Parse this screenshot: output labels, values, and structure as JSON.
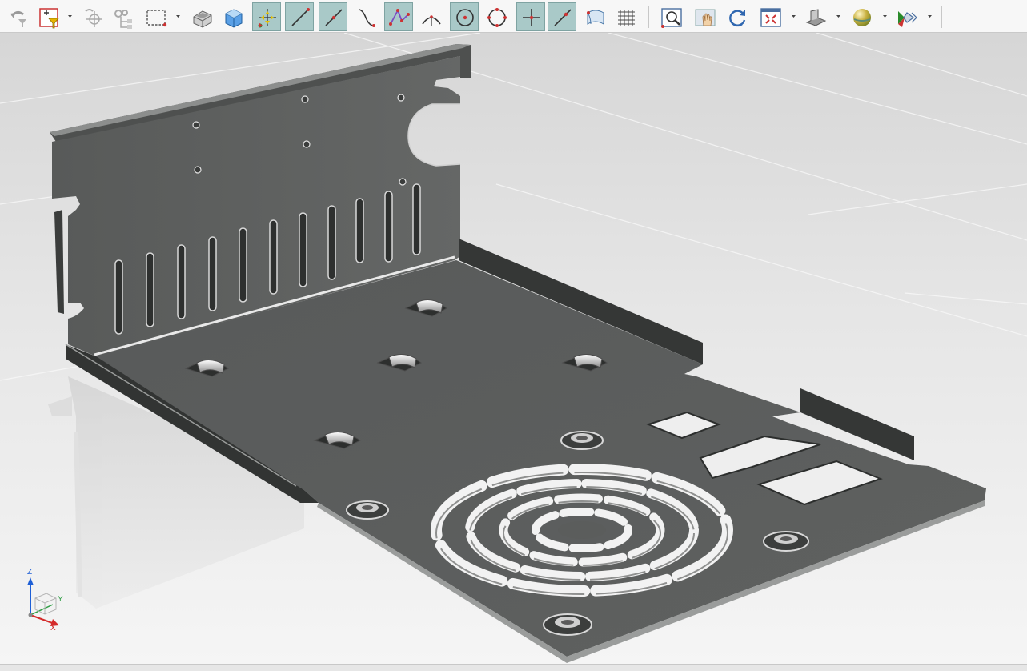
{
  "app": {
    "toolbar": {
      "buttons": [
        {
          "icon": "undo-filter-icon",
          "active": false
        },
        {
          "icon": "select-filter-icon",
          "active": false,
          "dropdown": true
        },
        {
          "icon": "point-snap-icon",
          "active": false
        },
        {
          "icon": "assembly-snap-icon",
          "active": false
        },
        {
          "icon": "box-select-icon",
          "active": false,
          "dropdown": true
        },
        {
          "icon": "part-view-icon",
          "active": false
        },
        {
          "icon": "solid-view-icon",
          "active": false
        },
        {
          "icon": "snap-points-icon",
          "active": true
        },
        {
          "icon": "line-icon",
          "active": true
        },
        {
          "icon": "line-midpoint-icon",
          "active": true
        },
        {
          "icon": "curve-icon",
          "active": false
        },
        {
          "icon": "polyline-icon",
          "active": true
        },
        {
          "icon": "angle-icon",
          "active": false
        },
        {
          "icon": "circle-center-icon",
          "active": true
        },
        {
          "icon": "circle-points-icon",
          "active": false
        },
        {
          "icon": "cross-point-icon",
          "active": true
        },
        {
          "icon": "line-point-icon",
          "active": true
        },
        {
          "icon": "surface-icon",
          "active": false
        },
        {
          "icon": "grid-icon",
          "active": false
        },
        {
          "icon": "zoom-area-icon",
          "active": false
        },
        {
          "icon": "pan-icon",
          "active": false
        },
        {
          "icon": "rotate-icon",
          "active": false
        },
        {
          "icon": "fit-view-icon",
          "active": false,
          "dropdown": true
        },
        {
          "icon": "view-orientation-icon",
          "active": false,
          "dropdown": true
        },
        {
          "icon": "render-style-icon",
          "active": false,
          "dropdown": true
        },
        {
          "icon": "display-options-icon",
          "active": false,
          "dropdown": true
        }
      ]
    },
    "viewport": {
      "model": "sheet-metal-bracket",
      "background_top": "#d9d9d9",
      "background_bottom": "#f4f4f4",
      "part_color": "#5b5d5c"
    },
    "triad": {
      "z_label": "Z",
      "y_label": "Y",
      "x_label": "X",
      "z_color": "#1e5fd6",
      "y_color": "#2f9e44",
      "x_color": "#d42a2a"
    }
  }
}
